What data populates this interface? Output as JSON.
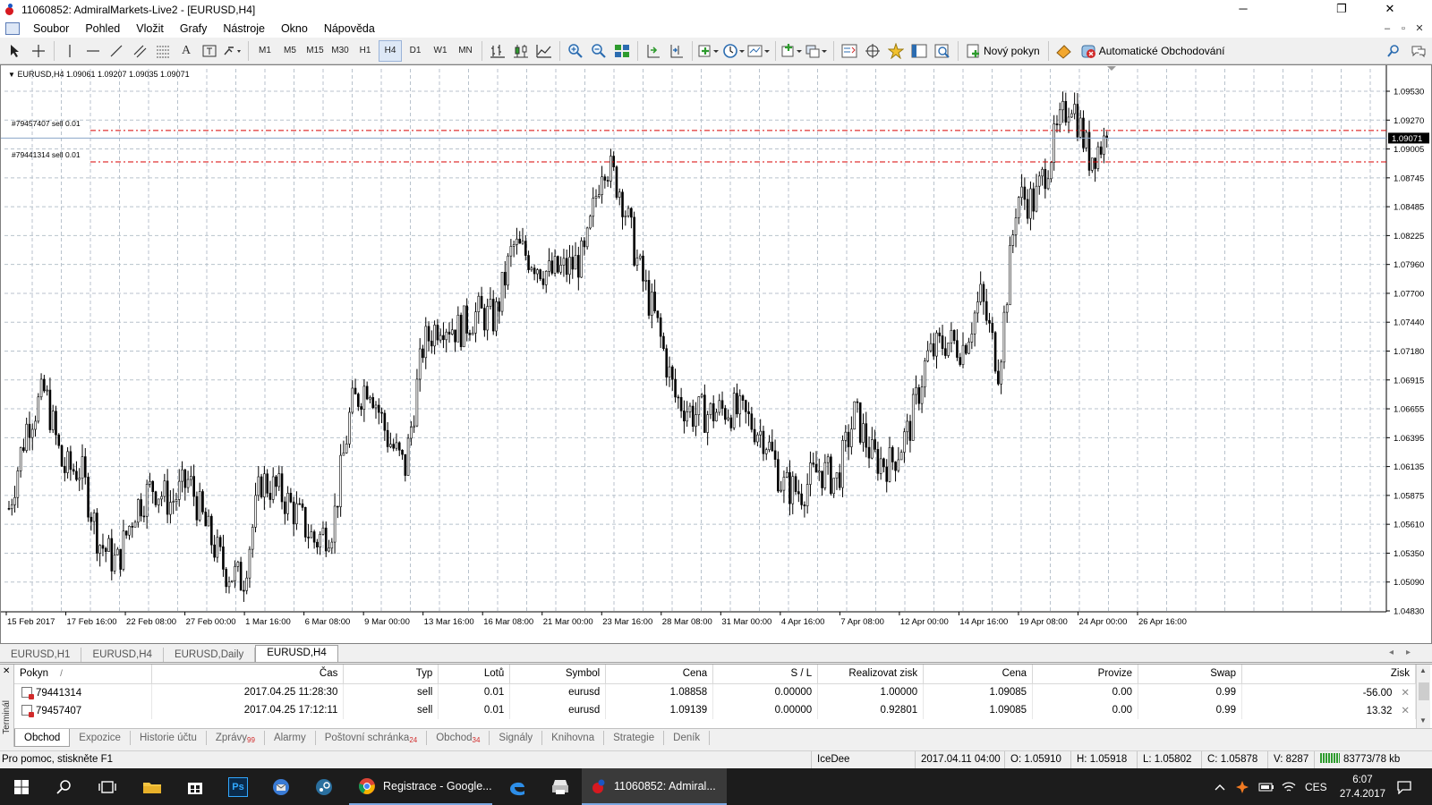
{
  "window": {
    "title": "11060852: AdmiralMarkets-Live2 - [EURUSD,H4]",
    "minimize": "─",
    "maximize": "❐",
    "close": "✕"
  },
  "menu": {
    "items": [
      "Soubor",
      "Pohled",
      "Vložit",
      "Grafy",
      "Nástroje",
      "Okno",
      "Nápověda"
    ],
    "mdi_controls": [
      "–",
      "▫",
      "✕"
    ]
  },
  "toolbar": {
    "timeframes": [
      "M1",
      "M5",
      "M15",
      "M30",
      "H1",
      "H4",
      "D1",
      "W1",
      "MN"
    ],
    "active_timeframe": "H4",
    "new_order_label": "Nový pokyn",
    "auto_trading_label": "Automatické Obchodování"
  },
  "chart": {
    "header": "EURUSD,H4  1.09061 1.09207 1.09035 1.09071",
    "symbol": "EURUSD",
    "timeframe": "H4",
    "ohlc": {
      "open": 1.09061,
      "high": 1.09207,
      "low": 1.09035,
      "close": 1.09071
    },
    "current_price_label": "1.09071",
    "colors": {
      "candle": "#000000",
      "order_line": "#d90000",
      "grid": "#b8c2cc",
      "price_tag_bg": "#000000"
    }
  },
  "chart_data": {
    "type": "candlestick",
    "symbol": "EURUSD",
    "timeframe": "H4",
    "ylim": [
      1.0483,
      1.0966
    ],
    "y_ticks": [
      "1.09530",
      "1.09270",
      "1.09005",
      "1.08745",
      "1.08485",
      "1.08225",
      "1.07960",
      "1.07700",
      "1.07440",
      "1.07180",
      "1.06915",
      "1.06655",
      "1.06395",
      "1.06135",
      "1.05875",
      "1.05610",
      "1.05350",
      "1.05090",
      "1.04830"
    ],
    "x_ticks": [
      "15 Feb 2017",
      "17 Feb 16:00",
      "22 Feb 08:00",
      "27 Feb 00:00",
      "1 Mar 16:00",
      "6 Mar 08:00",
      "9 Mar 00:00",
      "13 Mar 16:00",
      "16 Mar 08:00",
      "21 Mar 00:00",
      "23 Mar 16:00",
      "28 Mar 08:00",
      "31 Mar 00:00",
      "4 Apr 16:00",
      "7 Apr 08:00",
      "12 Apr 00:00",
      "14 Apr 16:00",
      "19 Apr 08:00",
      "24 Apr 00:00",
      "26 Apr 16:00"
    ],
    "close_path": [
      [
        "15 Feb 2017",
        1.0575
      ],
      [
        "16 Feb",
        1.065
      ],
      [
        "17 Feb",
        1.068
      ],
      [
        "17 Feb 16:00",
        1.061
      ],
      [
        "20 Feb",
        1.061
      ],
      [
        "21 Feb",
        1.0545
      ],
      [
        "22 Feb 08:00",
        1.0525
      ],
      [
        "23 Feb",
        1.0575
      ],
      [
        "24 Feb",
        1.0595
      ],
      [
        "27 Feb 00:00",
        1.058
      ],
      [
        "28 Feb",
        1.06
      ],
      [
        "1 Mar",
        1.0555
      ],
      [
        "1 Mar 16:00",
        1.052
      ],
      [
        "2 Mar",
        1.051
      ],
      [
        "3 Mar",
        1.06
      ],
      [
        "6 Mar 08:00",
        1.059
      ],
      [
        "7 Mar",
        1.057
      ],
      [
        "8 Mar",
        1.0545
      ],
      [
        "9 Mar 00:00",
        1.056
      ],
      [
        "10 Mar",
        1.0665
      ],
      [
        "13 Mar",
        1.069
      ],
      [
        "13 Mar 16:00",
        1.064
      ],
      [
        "14 Mar",
        1.061
      ],
      [
        "15 Mar",
        1.072
      ],
      [
        "16 Mar 08:00",
        1.0745
      ],
      [
        "17 Mar",
        1.0735
      ],
      [
        "20 Mar",
        1.075
      ],
      [
        "21 Mar 00:00",
        1.0745
      ],
      [
        "21 Mar 12:00",
        1.081
      ],
      [
        "22 Mar",
        1.08
      ],
      [
        "23 Mar",
        1.0785
      ],
      [
        "23 Mar 16:00",
        1.079
      ],
      [
        "24 Mar",
        1.08
      ],
      [
        "27 Mar",
        1.089
      ],
      [
        "28 Mar 08:00",
        1.086
      ],
      [
        "29 Mar",
        1.079
      ],
      [
        "30 Mar",
        1.074
      ],
      [
        "31 Mar 00:00",
        1.0675
      ],
      [
        "3 Apr",
        1.066
      ],
      [
        "4 Apr",
        1.066
      ],
      [
        "4 Apr 16:00",
        1.0665
      ],
      [
        "5 Apr",
        1.0655
      ],
      [
        "6 Apr",
        1.064
      ],
      [
        "7 Apr 08:00",
        1.0595
      ],
      [
        "10 Apr",
        1.059
      ],
      [
        "11 Apr",
        1.061
      ],
      [
        "12 Apr 00:00",
        1.06
      ],
      [
        "12 Apr 12:00",
        1.066
      ],
      [
        "13 Apr",
        1.062
      ],
      [
        "14 Apr 16:00",
        1.0615
      ],
      [
        "17 Apr",
        1.0645
      ],
      [
        "18 Apr",
        1.071
      ],
      [
        "19 Apr",
        1.0725
      ],
      [
        "19 Apr 08:00",
        1.072
      ],
      [
        "20 Apr",
        1.0765
      ],
      [
        "21 Apr",
        1.07
      ],
      [
        "24 Apr 00:00",
        1.0855
      ],
      [
        "24 Apr 12:00",
        1.085
      ],
      [
        "25 Apr",
        1.09
      ],
      [
        "25 Apr 12:00",
        1.0945
      ],
      [
        "26 Apr",
        1.089
      ],
      [
        "26 Apr 16:00",
        1.0907
      ]
    ],
    "horizontal_lines": [
      {
        "label": "#79457407 sell 0.01",
        "price": 1.09139
      },
      {
        "label": "#79441314 sell 0.01",
        "price": 1.08858
      },
      {
        "label": "1.09071",
        "price": 1.09071
      }
    ],
    "grid": true
  },
  "chart_tabs": [
    "EURUSD,H1",
    "EURUSD,H4",
    "EURUSD,Daily",
    "EURUSD,H4"
  ],
  "chart_tabs_active": 3,
  "terminal": {
    "side_label": "Terminál",
    "columns": [
      "Pokyn",
      "Čas",
      "Typ",
      "Lotů",
      "Symbol",
      "Cena",
      "S / L",
      "Realizovat zisk",
      "Cena",
      "Provize",
      "Swap",
      "Zisk"
    ],
    "rows": [
      [
        "79441314",
        "2017.04.25 11:28:30",
        "sell",
        "0.01",
        "eurusd",
        "1.08858",
        "0.00000",
        "1.00000",
        "1.09085",
        "0.00",
        "0.99",
        "-56.00"
      ],
      [
        "79457407",
        "2017.04.25 17:12:11",
        "sell",
        "0.01",
        "eurusd",
        "1.09139",
        "0.00000",
        "0.92801",
        "1.09085",
        "0.00",
        "0.99",
        "13.32"
      ]
    ],
    "tabs": [
      {
        "label": "Obchod",
        "badge": ""
      },
      {
        "label": "Expozice",
        "badge": ""
      },
      {
        "label": "Historie účtu",
        "badge": ""
      },
      {
        "label": "Zprávy",
        "badge": "99"
      },
      {
        "label": "Alarmy",
        "badge": ""
      },
      {
        "label": "Poštovní schránka",
        "badge": "24"
      },
      {
        "label": "Obchod",
        "badge": "34"
      },
      {
        "label": "Signály",
        "badge": ""
      },
      {
        "label": "Knihovna",
        "badge": ""
      },
      {
        "label": "Strategie",
        "badge": ""
      },
      {
        "label": "Deník",
        "badge": ""
      }
    ]
  },
  "status": {
    "help": "Pro pomoc, stiskněte F1",
    "profile": "IceDee",
    "time": "2017.04.11 04:00",
    "open": "O: 1.05910",
    "high": "H: 1.05918",
    "low": "L: 1.05802",
    "close": "C: 1.05878",
    "volume": "V: 8287",
    "traffic": "83773/78 kb"
  },
  "taskbar": {
    "apps": [
      {
        "name": "chrome",
        "label": "Registrace - Google..."
      },
      {
        "name": "mt4",
        "label": "11060852: Admiral..."
      }
    ],
    "language": "CES",
    "time": "6:07",
    "date": "27.4.2017"
  }
}
